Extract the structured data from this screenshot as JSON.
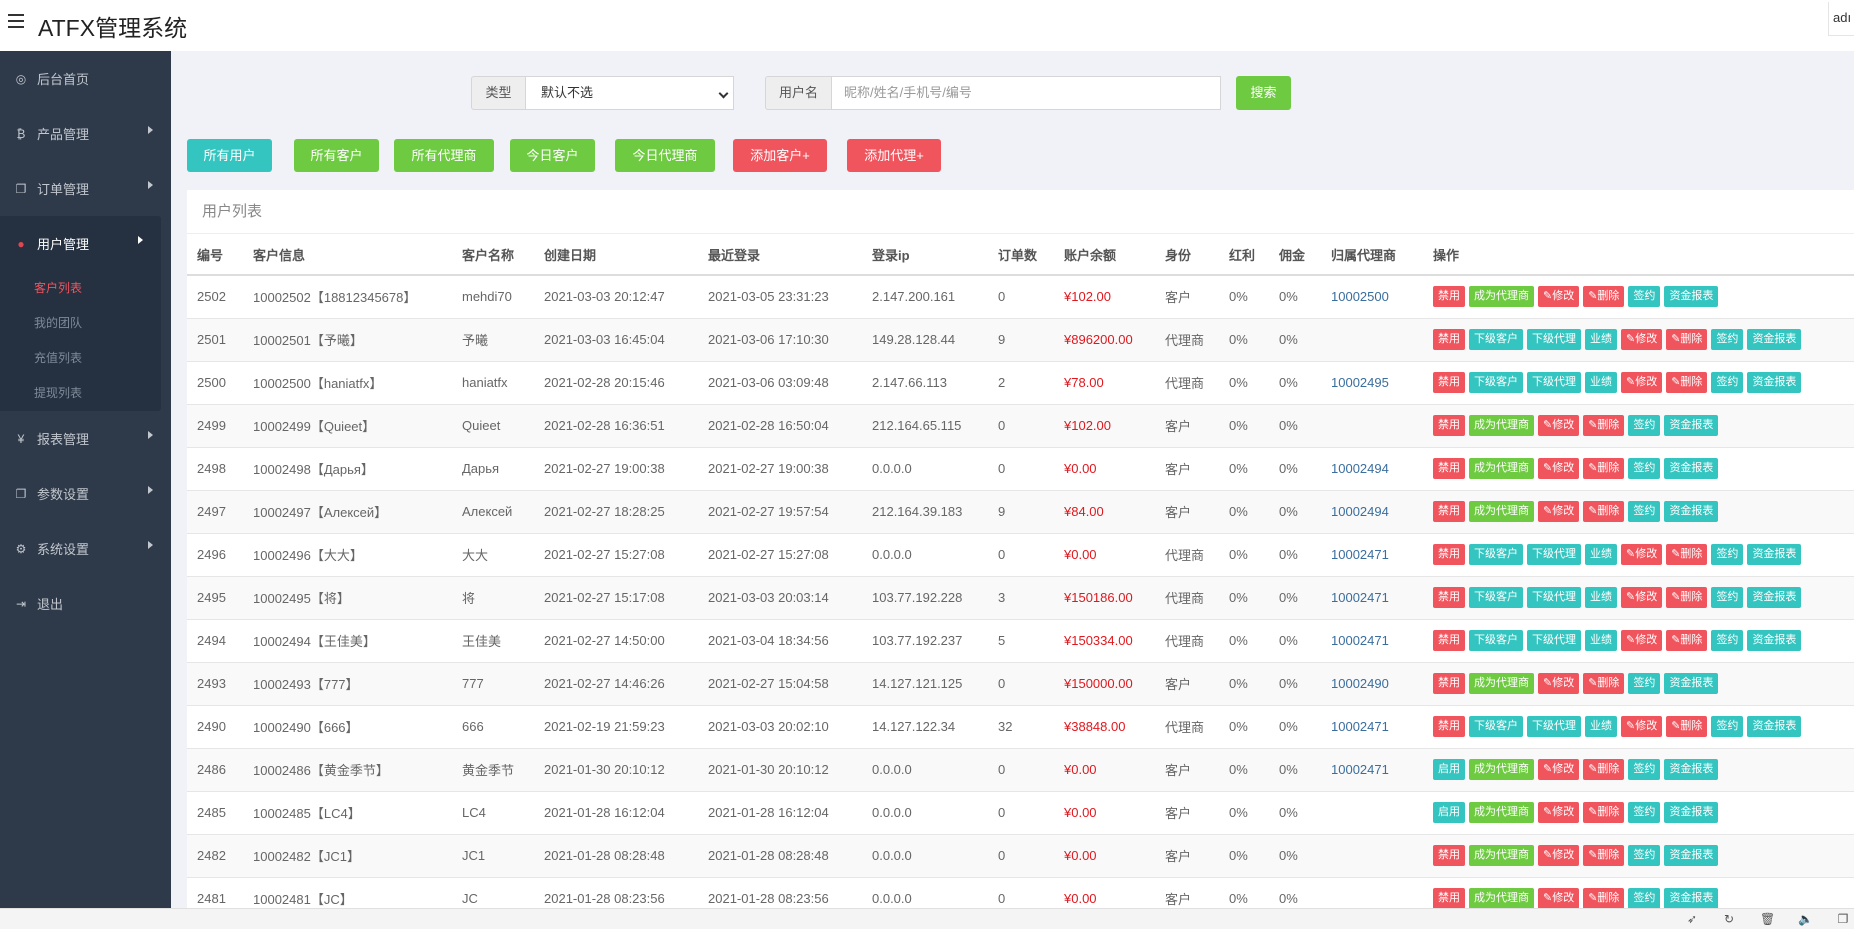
{
  "app": {
    "title": "ATFX管理系统",
    "user": "adı"
  },
  "sidebar": {
    "items": [
      {
        "label": "后台首页",
        "icon": "dashboard-icon",
        "glyph": "◎",
        "arrow": false
      },
      {
        "label": "产品管理",
        "icon": "bitcoin-icon",
        "glyph": "₿",
        "arrow": true
      },
      {
        "label": "订单管理",
        "icon": "copy-icon",
        "glyph": "❐",
        "arrow": true
      },
      {
        "label": "用户管理",
        "icon": "user-icon",
        "glyph": "●",
        "arrow": true,
        "active": true,
        "children": [
          {
            "label": "客户列表",
            "active": true
          },
          {
            "label": "我的团队"
          },
          {
            "label": "充值列表"
          },
          {
            "label": "提现列表"
          }
        ]
      },
      {
        "label": "报表管理",
        "icon": "yen-icon",
        "glyph": "¥",
        "arrow": true
      },
      {
        "label": "参数设置",
        "icon": "copy-icon",
        "glyph": "❐",
        "arrow": true
      },
      {
        "label": "系统设置",
        "icon": "gears-icon",
        "glyph": "⚙",
        "arrow": true
      },
      {
        "label": "退出",
        "icon": "signout-icon",
        "glyph": "⇥",
        "arrow": false
      }
    ]
  },
  "filters": {
    "type_label": "类型",
    "type_value": "默认不选",
    "user_label": "用户名",
    "user_placeholder": "昵称/姓名/手机号/编号",
    "search_label": "搜索"
  },
  "quick_buttons": [
    {
      "label": "所有用户",
      "color": "teal"
    },
    {
      "label": "所有客户",
      "color": "green"
    },
    {
      "label": "所有代理商",
      "color": "green"
    },
    {
      "label": "今日客户",
      "color": "green"
    },
    {
      "label": "今日代理商",
      "color": "green"
    },
    {
      "label": "添加客户+",
      "color": "red"
    },
    {
      "label": "添加代理+",
      "color": "red"
    }
  ],
  "panel": {
    "title": "用户列表"
  },
  "table": {
    "columns": [
      "编号",
      "客户信息",
      "客户名称",
      "创建日期",
      "最近登录",
      "登录ip",
      "订单数",
      "账户余额",
      "身份",
      "红利",
      "佣金",
      "归属代理商",
      "操作"
    ],
    "rows": [
      {
        "id": "2502",
        "info": "10002502【18812345678】",
        "name": "mehdi70",
        "created": "2021-03-03 20:12:47",
        "last_login": "2021-03-05 23:31:23",
        "ip": "2.147.200.161",
        "orders": "0",
        "balance": "¥102.00",
        "role": "客户",
        "bonus": "0%",
        "commission": "0%",
        "agent": "10002500",
        "ops": [
          "禁用",
          "成为代理商",
          "✎修改",
          "✎删除",
          "签约",
          "资金报表"
        ]
      },
      {
        "id": "2501",
        "info": "10002501【予曦】",
        "name": "予曦",
        "created": "2021-03-03 16:45:04",
        "last_login": "2021-03-06 17:10:30",
        "ip": "149.28.128.44",
        "orders": "9",
        "balance": "¥896200.00",
        "role": "代理商",
        "bonus": "0%",
        "commission": "0%",
        "agent": "",
        "ops": [
          "禁用",
          "下级客户",
          "下级代理",
          "业绩",
          "✎修改",
          "✎删除",
          "签约",
          "资金报表"
        ]
      },
      {
        "id": "2500",
        "info": "10002500【haniatfx】",
        "name": "haniatfx",
        "created": "2021-02-28 20:15:46",
        "last_login": "2021-03-06 03:09:48",
        "ip": "2.147.66.113",
        "orders": "2",
        "balance": "¥78.00",
        "role": "代理商",
        "bonus": "0%",
        "commission": "0%",
        "agent": "10002495",
        "ops": [
          "禁用",
          "下级客户",
          "下级代理",
          "业绩",
          "✎修改",
          "✎删除",
          "签约",
          "资金报表"
        ]
      },
      {
        "id": "2499",
        "info": "10002499【Quieet】",
        "name": "Quieet",
        "created": "2021-02-28 16:36:51",
        "last_login": "2021-02-28 16:50:04",
        "ip": "212.164.65.115",
        "orders": "0",
        "balance": "¥102.00",
        "role": "客户",
        "bonus": "0%",
        "commission": "0%",
        "agent": "",
        "ops": [
          "禁用",
          "成为代理商",
          "✎修改",
          "✎删除",
          "签约",
          "资金报表"
        ]
      },
      {
        "id": "2498",
        "info": "10002498【Дарья】",
        "name": "Дарья",
        "created": "2021-02-27 19:00:38",
        "last_login": "2021-02-27 19:00:38",
        "ip": "0.0.0.0",
        "orders": "0",
        "balance": "¥0.00",
        "role": "客户",
        "bonus": "0%",
        "commission": "0%",
        "agent": "10002494",
        "ops": [
          "禁用",
          "成为代理商",
          "✎修改",
          "✎删除",
          "签约",
          "资金报表"
        ]
      },
      {
        "id": "2497",
        "info": "10002497【Алексей】",
        "name": "Алексей",
        "created": "2021-02-27 18:28:25",
        "last_login": "2021-02-27 19:57:54",
        "ip": "212.164.39.183",
        "orders": "9",
        "balance": "¥84.00",
        "role": "客户",
        "bonus": "0%",
        "commission": "0%",
        "agent": "10002494",
        "ops": [
          "禁用",
          "成为代理商",
          "✎修改",
          "✎删除",
          "签约",
          "资金报表"
        ]
      },
      {
        "id": "2496",
        "info": "10002496【大大】",
        "name": "大大",
        "created": "2021-02-27 15:27:08",
        "last_login": "2021-02-27 15:27:08",
        "ip": "0.0.0.0",
        "orders": "0",
        "balance": "¥0.00",
        "role": "代理商",
        "bonus": "0%",
        "commission": "0%",
        "agent": "10002471",
        "ops": [
          "禁用",
          "下级客户",
          "下级代理",
          "业绩",
          "✎修改",
          "✎删除",
          "签约",
          "资金报表"
        ]
      },
      {
        "id": "2495",
        "info": "10002495【将】",
        "name": "将",
        "created": "2021-02-27 15:17:08",
        "last_login": "2021-03-03 20:03:14",
        "ip": "103.77.192.228",
        "orders": "3",
        "balance": "¥150186.00",
        "role": "代理商",
        "bonus": "0%",
        "commission": "0%",
        "agent": "10002471",
        "ops": [
          "禁用",
          "下级客户",
          "下级代理",
          "业绩",
          "✎修改",
          "✎删除",
          "签约",
          "资金报表"
        ]
      },
      {
        "id": "2494",
        "info": "10002494【王佳美】",
        "name": "王佳美",
        "created": "2021-02-27 14:50:00",
        "last_login": "2021-03-04 18:34:56",
        "ip": "103.77.192.237",
        "orders": "5",
        "balance": "¥150334.00",
        "role": "代理商",
        "bonus": "0%",
        "commission": "0%",
        "agent": "10002471",
        "ops": [
          "禁用",
          "下级客户",
          "下级代理",
          "业绩",
          "✎修改",
          "✎删除",
          "签约",
          "资金报表"
        ]
      },
      {
        "id": "2493",
        "info": "10002493【777】",
        "name": "777",
        "created": "2021-02-27 14:46:26",
        "last_login": "2021-02-27 15:04:58",
        "ip": "14.127.121.125",
        "orders": "0",
        "balance": "¥150000.00",
        "role": "客户",
        "bonus": "0%",
        "commission": "0%",
        "agent": "10002490",
        "ops": [
          "禁用",
          "成为代理商",
          "✎修改",
          "✎删除",
          "签约",
          "资金报表"
        ]
      },
      {
        "id": "2490",
        "info": "10002490【666】",
        "name": "666",
        "created": "2021-02-19 21:59:23",
        "last_login": "2021-03-03 20:02:10",
        "ip": "14.127.122.34",
        "orders": "32",
        "balance": "¥38848.00",
        "role": "代理商",
        "bonus": "0%",
        "commission": "0%",
        "agent": "10002471",
        "ops": [
          "禁用",
          "下级客户",
          "下级代理",
          "业绩",
          "✎修改",
          "✎删除",
          "签约",
          "资金报表"
        ]
      },
      {
        "id": "2486",
        "info": "10002486【黄金季节】",
        "name": "黄金季节",
        "created": "2021-01-30 20:10:12",
        "last_login": "2021-01-30 20:10:12",
        "ip": "0.0.0.0",
        "orders": "0",
        "balance": "¥0.00",
        "role": "客户",
        "bonus": "0%",
        "commission": "0%",
        "agent": "10002471",
        "ops": [
          "启用",
          "成为代理商",
          "✎修改",
          "✎删除",
          "签约",
          "资金报表"
        ]
      },
      {
        "id": "2485",
        "info": "10002485【LC4】",
        "name": "LC4",
        "created": "2021-01-28 16:12:04",
        "last_login": "2021-01-28 16:12:04",
        "ip": "0.0.0.0",
        "orders": "0",
        "balance": "¥0.00",
        "role": "客户",
        "bonus": "0%",
        "commission": "0%",
        "agent": "",
        "ops": [
          "启用",
          "成为代理商",
          "✎修改",
          "✎删除",
          "签约",
          "资金报表"
        ]
      },
      {
        "id": "2482",
        "info": "10002482【JC1】",
        "name": "JC1",
        "created": "2021-01-28 08:28:48",
        "last_login": "2021-01-28 08:28:48",
        "ip": "0.0.0.0",
        "orders": "0",
        "balance": "¥0.00",
        "role": "客户",
        "bonus": "0%",
        "commission": "0%",
        "agent": "",
        "ops": [
          "禁用",
          "成为代理商",
          "✎修改",
          "✎删除",
          "签约",
          "资金报表"
        ]
      },
      {
        "id": "2481",
        "info": "10002481【JC】",
        "name": "JC",
        "created": "2021-01-28 08:23:56",
        "last_login": "2021-01-28 08:23:56",
        "ip": "0.0.0.0",
        "orders": "0",
        "balance": "¥0.00",
        "role": "客户",
        "bonus": "0%",
        "commission": "0%",
        "agent": "",
        "ops": [
          "禁用",
          "成为代理商",
          "✎修改",
          "✎删除",
          "签约",
          "资金报表"
        ]
      }
    ]
  },
  "op_colors": {
    "禁用": "red",
    "启用": "teal",
    "成为代理商": "green",
    "下级客户": "teal",
    "下级代理": "teal",
    "业绩": "teal",
    "✎修改": "red",
    "✎删除": "red",
    "签约": "teal",
    "资金报表": "teal"
  },
  "statusbar": {
    "icons": [
      {
        "name": "rocket-icon",
        "glyph": "➶"
      },
      {
        "name": "refresh-icon",
        "glyph": "↻"
      },
      {
        "name": "trash-icon",
        "glyph": "🗑"
      },
      {
        "name": "speaker-icon",
        "glyph": "🔈"
      },
      {
        "name": "window-icon",
        "glyph": "❐"
      }
    ]
  },
  "colors": {
    "sidebar": "#2e3a49",
    "teal": "#35c5c0",
    "green": "#6ecb41",
    "red": "#f0555e",
    "balance": "#e0181e"
  }
}
